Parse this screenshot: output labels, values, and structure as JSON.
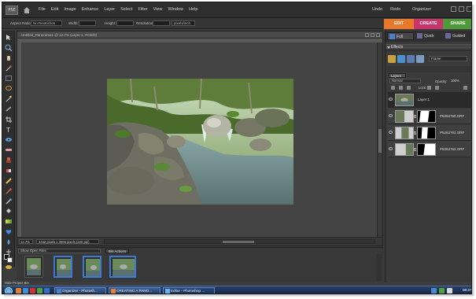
{
  "app": {
    "logo": "PSE",
    "menus": [
      "File",
      "Edit",
      "Image",
      "Enhance",
      "Layer",
      "Select",
      "Filter",
      "View",
      "Window",
      "Help"
    ],
    "undo": "Undo",
    "redo": "Redo",
    "organizer": "Organizer"
  },
  "mode_tabs": {
    "edit": "EDIT",
    "create": "CREATE",
    "share": "SHARE",
    "colors": {
      "edit": "#e8782a",
      "create": "#c9356b",
      "share": "#4e9a3a"
    }
  },
  "options_bar": {
    "aspect_label": "Aspect Ratio:",
    "aspect_value": "No Restriction",
    "width_label": "Width:",
    "height_label": "Height:",
    "resolution_label": "Resolution:",
    "units_value": "pixels/inch"
  },
  "document": {
    "title": "Untitled_Panorama1 @ 12.7% (Layer 1, RGB/8)",
    "zoom": "12.7%",
    "doc_size": "4442 pixels x 3006 pixels (240 ppi)"
  },
  "palette_bin": {
    "edit_tabs": [
      "Full",
      "Quick",
      "Guided"
    ],
    "effects_title": "Effects",
    "effects_filter": "Frame",
    "layers_title": "Layers",
    "blend_mode": "Normal",
    "opacity_label": "Opacity:",
    "opacity_value": "100%",
    "lock_label": "Lock:",
    "layers": [
      {
        "name": "Layer 1",
        "selected": true,
        "masked": false
      },
      {
        "name": "P5262760.ORF",
        "selected": false,
        "masked": true
      },
      {
        "name": "P5262761.ORF",
        "selected": false,
        "masked": true
      },
      {
        "name": "P5262762.ORF",
        "selected": false,
        "masked": true
      }
    ]
  },
  "project_bin": {
    "show_files": "Show Open Files",
    "bin_actions": "Bin Actions",
    "hide_label": "Hide Project Bin"
  },
  "taskbar": {
    "buttons": [
      "Organizer - Photosh...",
      "CREATING A PANO...",
      "Editor - Photoshop ..."
    ],
    "clock": "08:27"
  },
  "icons": [
    "home-icon",
    "move-icon",
    "zoom-icon",
    "hand-icon",
    "eyedropper-icon",
    "marquee-icon",
    "lasso-icon",
    "magic-wand-icon",
    "crop-icon",
    "type-icon",
    "brush-icon",
    "eraser-icon",
    "paint-bucket-icon",
    "gradient-icon",
    "shape-icon",
    "eye-icon",
    "start-orb-icon"
  ]
}
